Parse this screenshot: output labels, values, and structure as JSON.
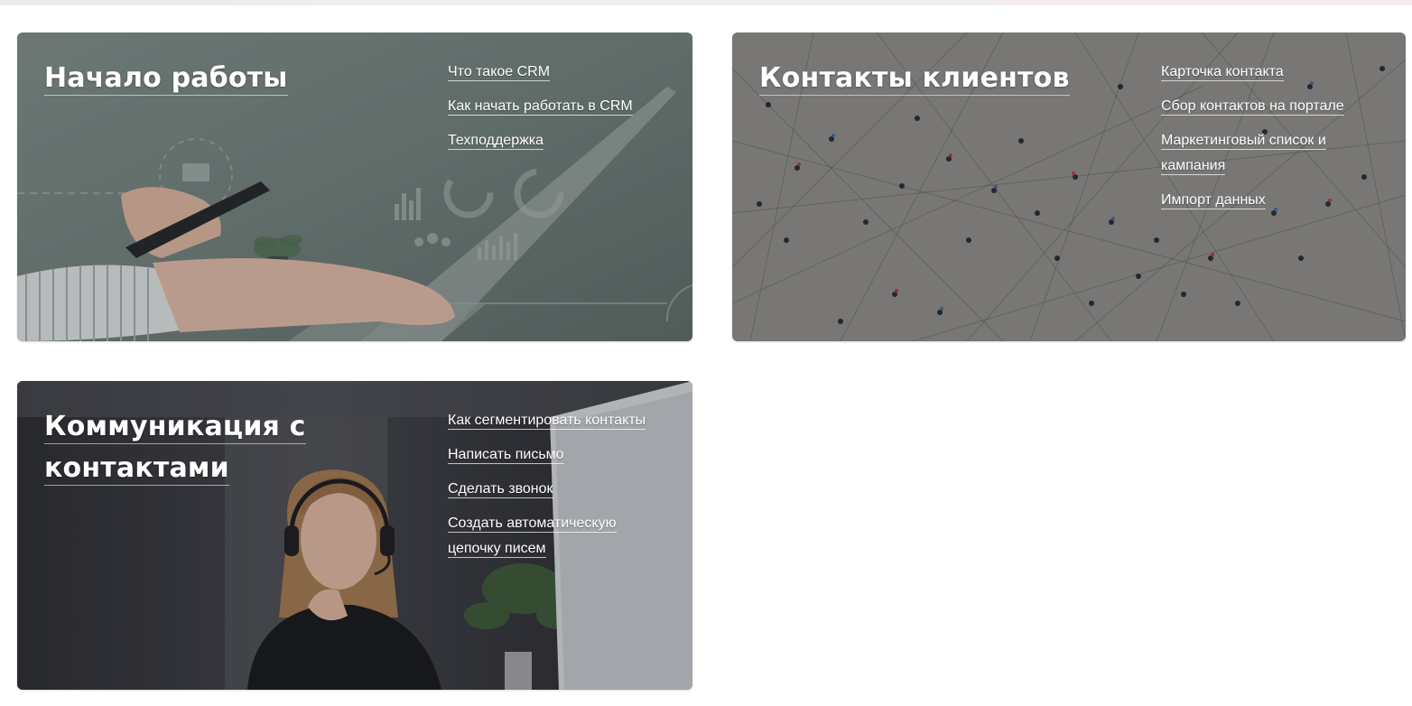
{
  "cards": [
    {
      "title_lines": [
        "Начало работы"
      ],
      "links": [
        "Что такое CRM",
        "Как начать работать в CRM",
        "Техподдержка"
      ]
    },
    {
      "title_lines": [
        "Контакты клиентов"
      ],
      "links": [
        "Карточка контакта",
        "Сбор контактов на портале",
        "Маркетинговый список и кампания",
        "Импорт данных"
      ]
    },
    {
      "title_lines": [
        "Коммуникация с",
        "контактами"
      ],
      "links": [
        "Как сегментировать контакты",
        "Написать письмо",
        "Сделать звонок",
        "Создать автоматическую цепочку писем"
      ]
    }
  ],
  "colors": {
    "text": "#ffffff",
    "card1_base": "#6f7c78",
    "card2_base": "#8c8c8a",
    "card3_base": "#3b3c40"
  }
}
